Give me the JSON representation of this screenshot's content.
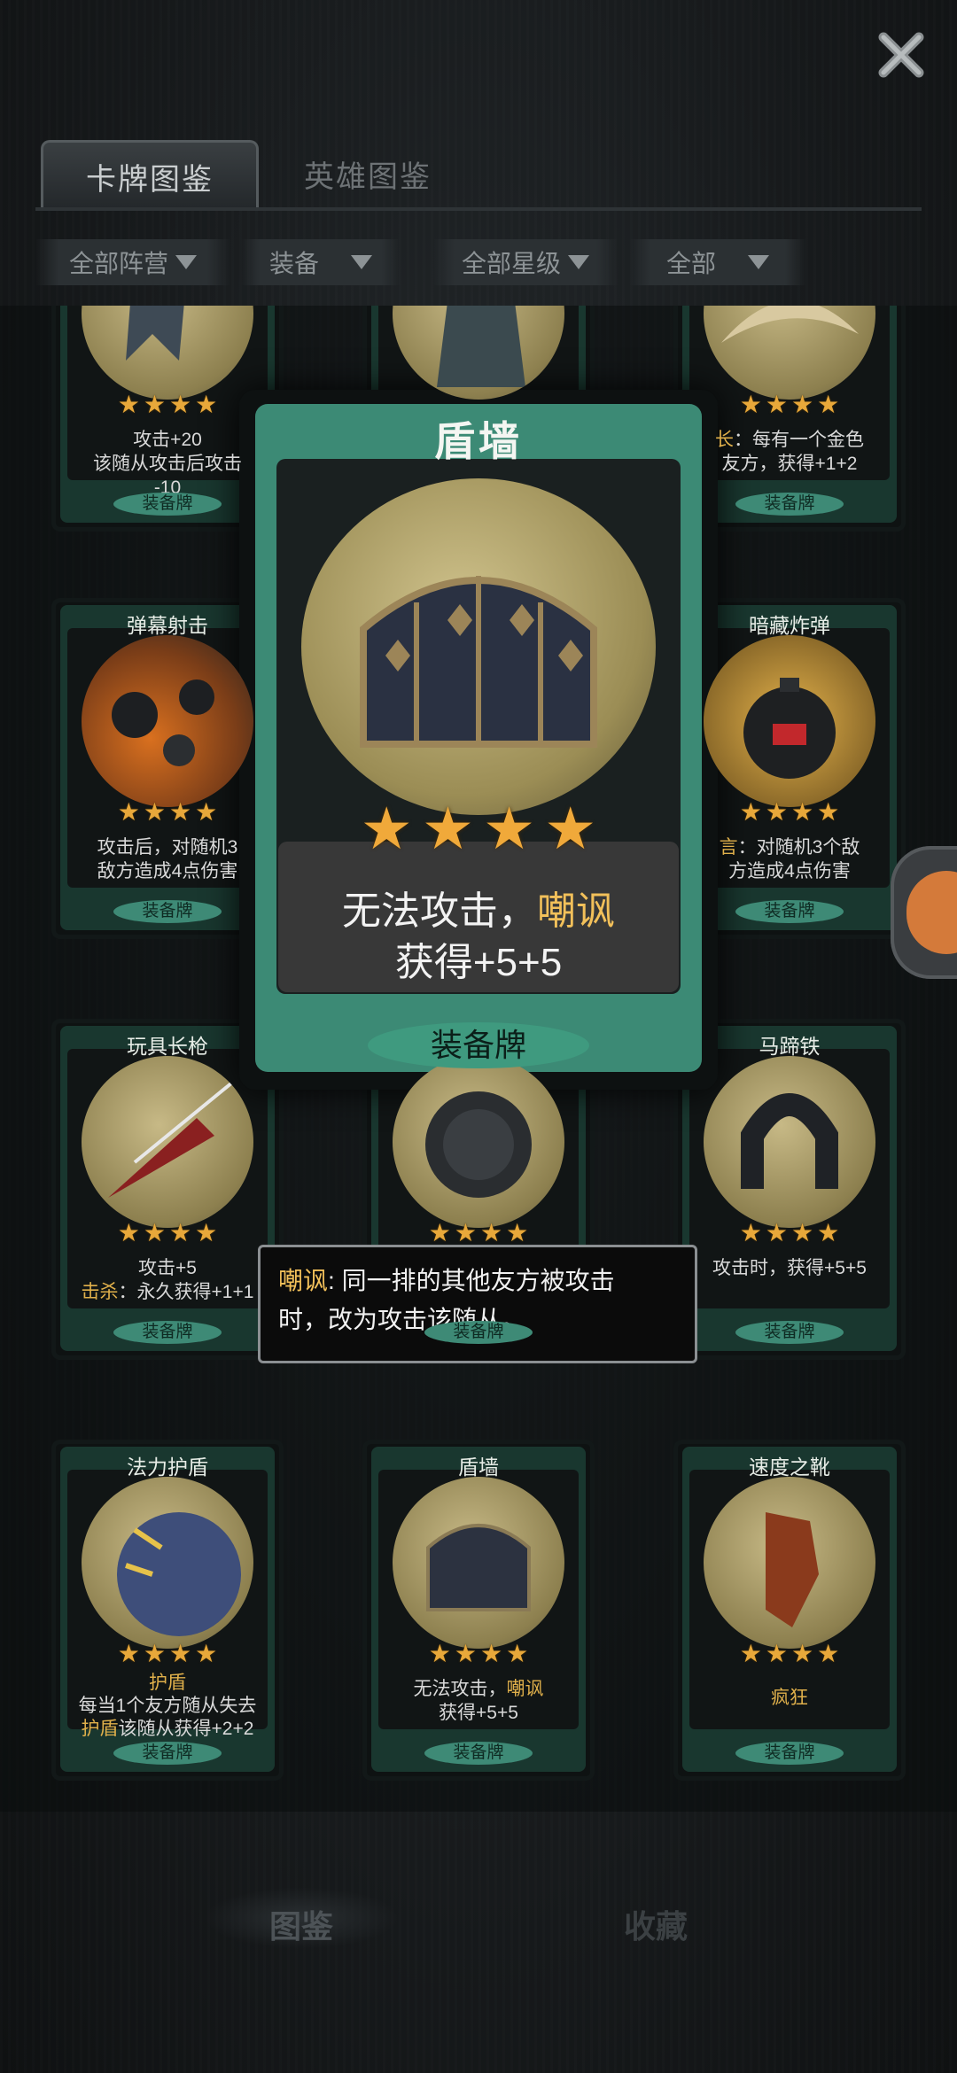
{
  "header": {
    "tabs": [
      {
        "label": "卡牌图鉴",
        "active": true
      },
      {
        "label": "英雄图鉴",
        "active": false
      }
    ],
    "filters": [
      {
        "label": "全部阵营"
      },
      {
        "label": "装备"
      },
      {
        "label": "全部星级"
      },
      {
        "label": "全部"
      }
    ]
  },
  "cards": [
    {
      "name": "",
      "stars": 4,
      "desc_line1": "攻击+20",
      "desc_line2": "该随从攻击后攻击",
      "desc_line3": "-10",
      "type": "装备牌"
    },
    {
      "name": "",
      "stars": 4,
      "desc_line1": "",
      "desc_line2": "",
      "desc_line3": "",
      "type": ""
    },
    {
      "name": "",
      "stars": 4,
      "desc_line1": "长：每有一个金色",
      "desc_line2": "友方，获得+1+2",
      "desc_line3": "",
      "type": "装备牌"
    },
    {
      "name": "弹幕射击",
      "stars": 4,
      "desc_line1": "攻击后，对随机3",
      "desc_line2": "敌方造成4点伤害",
      "type": "装备牌"
    },
    {
      "name": "暗藏炸弹",
      "stars": 4,
      "desc_line1": "言：对随机3个敌",
      "desc_line2": "方造成4点伤害",
      "type": "装备牌"
    },
    {
      "name": "玩具长枪",
      "stars": 4,
      "desc_line1": "攻击+5",
      "desc_line2_hl": "击杀",
      "desc_line2": "：永久获得+1+1",
      "type": "装备牌"
    },
    {
      "name": "",
      "stars": 4,
      "desc_line1": "",
      "desc_line2": "",
      "type": "装备牌"
    },
    {
      "name": "马蹄铁",
      "stars": 4,
      "desc_line1": "攻击时，获得+5+5",
      "desc_line2": "",
      "type": "装备牌"
    },
    {
      "name": "法力护盾",
      "stars": 4,
      "desc_hl": "护盾",
      "desc_line1": "每当1个友方随从失去",
      "desc_line2_hl": "护盾",
      "desc_line2": "该随从获得+2+2",
      "type": "装备牌"
    },
    {
      "name": "盾墙",
      "stars": 4,
      "desc_line1": "无法攻击，",
      "desc_line1_hl": "嘲讽",
      "desc_line2": "获得+5+5",
      "type": "装备牌"
    },
    {
      "name": "速度之靴",
      "stars": 4,
      "desc_hl": "疯狂",
      "type": "装备牌"
    }
  ],
  "popup": {
    "name": "盾墙",
    "stars": 4,
    "desc_line1": "无法攻击，",
    "desc_line1_hl": "嘲讽",
    "desc_line2": "获得+5+5",
    "type": "装备牌"
  },
  "tooltip": {
    "keyword": "嘲讽",
    "text_line1": ": 同一排的其他友方被攻击",
    "text_line2": "时，改为攻击该随从。"
  },
  "nav": {
    "items": [
      {
        "label": "图鉴",
        "active": true
      },
      {
        "label": "收藏",
        "active": false
      }
    ]
  },
  "colors": {
    "card_frame": "#2d6b5a",
    "star": "#e8a83a",
    "keyword_highlight": "#f2c05a",
    "background": "#141719"
  }
}
